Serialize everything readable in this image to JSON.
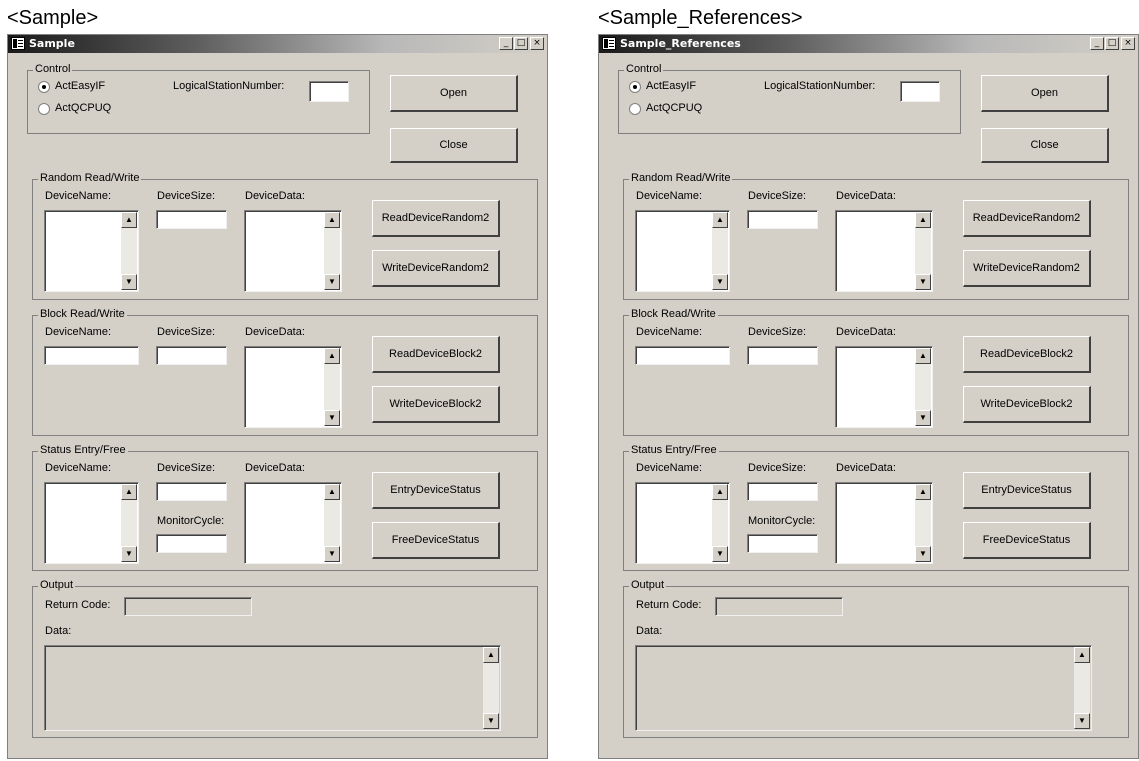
{
  "windows": [
    {
      "caption": "<Sample>",
      "title": "Sample",
      "caption_buttons": [
        "_",
        "□",
        "×"
      ],
      "control": {
        "label": "Control",
        "radio1": "ActEasyIF",
        "radio2": "ActQCPUQ",
        "station_label": "LogicalStationNumber:",
        "station_value": "",
        "selected": "ActEasyIF"
      },
      "buttons": {
        "open": "Open",
        "close": "Close"
      },
      "random": {
        "label": "Random Read/Write",
        "device_name": "DeviceName:",
        "device_size": "DeviceSize:",
        "device_data": "DeviceData:",
        "read_btn": "ReadDeviceRandom2",
        "write_btn": "WriteDeviceRandom2"
      },
      "block": {
        "label": "Block Read/Write",
        "device_name": "DeviceName:",
        "device_size": "DeviceSize:",
        "device_data": "DeviceData:",
        "read_btn": "ReadDeviceBlock2",
        "write_btn": "WriteDeviceBlock2"
      },
      "status": {
        "label": "Status Entry/Free",
        "device_name": "DeviceName:",
        "device_size": "DeviceSize:",
        "device_data": "DeviceData:",
        "monitor_cycle": "MonitorCycle:",
        "entry_btn": "EntryDeviceStatus",
        "free_btn": "FreeDeviceStatus"
      },
      "output": {
        "label": "Output",
        "return_code": "Return Code:",
        "data": "Data:"
      }
    },
    {
      "caption": "<Sample_References>",
      "title": "Sample_References",
      "caption_buttons": [
        "_",
        "□",
        "×"
      ],
      "control": {
        "label": "Control",
        "radio1": "ActEasyIF",
        "radio2": "ActQCPUQ",
        "station_label": "LogicalStationNumber:",
        "station_value": "",
        "selected": "ActEasyIF"
      },
      "buttons": {
        "open": "Open",
        "close": "Close"
      },
      "random": {
        "label": "Random Read/Write",
        "device_name": "DeviceName:",
        "device_size": "DeviceSize:",
        "device_data": "DeviceData:",
        "read_btn": "ReadDeviceRandom2",
        "write_btn": "WriteDeviceRandom2"
      },
      "block": {
        "label": "Block Read/Write",
        "device_name": "DeviceName:",
        "device_size": "DeviceSize:",
        "device_data": "DeviceData:",
        "read_btn": "ReadDeviceBlock2",
        "write_btn": "WriteDeviceBlock2"
      },
      "status": {
        "label": "Status Entry/Free",
        "device_name": "DeviceName:",
        "device_size": "DeviceSize:",
        "device_data": "DeviceData:",
        "monitor_cycle": "MonitorCycle:",
        "entry_btn": "EntryDeviceStatus",
        "free_btn": "FreeDeviceStatus"
      },
      "output": {
        "label": "Output",
        "return_code": "Return Code:",
        "data": "Data:"
      }
    }
  ]
}
